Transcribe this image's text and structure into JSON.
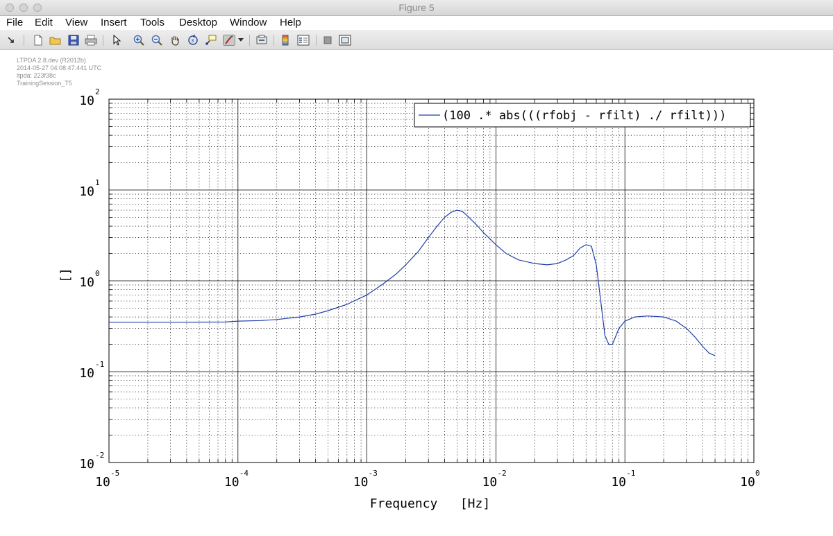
{
  "window": {
    "title": "Figure 5"
  },
  "menu": {
    "items": [
      "File",
      "Edit",
      "View",
      "Insert",
      "Tools",
      "Desktop",
      "Window",
      "Help"
    ]
  },
  "toolbar": {
    "icons": [
      "arrow-icon",
      "new-figure-icon",
      "open-icon",
      "save-icon",
      "print-icon",
      "pointer-icon",
      "zoom-in-icon",
      "zoom-out-icon",
      "pan-icon",
      "rotate-3d-icon",
      "data-cursor-icon",
      "brush-icon",
      "brush-dropdown-icon",
      "link-plot-icon",
      "colorbar-icon",
      "legend-icon",
      "hide-plot-tools-icon",
      "show-plot-tools-icon"
    ]
  },
  "metadata": {
    "lines": [
      "LTPDA 2.8.dev (R2012b)",
      "2014-05-27 04:08:47.441 UTC",
      "ltpda: 223f38c",
      "TrainingSession_T5"
    ]
  },
  "colors": {
    "series": "#1f3fa8",
    "grid_major": "#000000",
    "grid_minor": "#000000"
  },
  "chart_data": {
    "type": "line",
    "xscale": "log",
    "yscale": "log",
    "xlim": [
      1e-05,
      1
    ],
    "ylim": [
      0.01,
      100
    ],
    "xlabel": "Frequency   [Hz]",
    "ylabel": "[]",
    "grid": "major and minor",
    "legend_position": "top-right",
    "x_ticks": [
      {
        "base": "10",
        "exp": "-5"
      },
      {
        "base": "10",
        "exp": "-4"
      },
      {
        "base": "10",
        "exp": "-3"
      },
      {
        "base": "10",
        "exp": "-2"
      },
      {
        "base": "10",
        "exp": "-1"
      },
      {
        "base": "10",
        "exp": "0"
      }
    ],
    "y_ticks": [
      {
        "base": "10",
        "exp": "-2"
      },
      {
        "base": "10",
        "exp": "-1"
      },
      {
        "base": "10",
        "exp": "0"
      },
      {
        "base": "10",
        "exp": "1"
      },
      {
        "base": "10",
        "exp": "2"
      }
    ],
    "series": [
      {
        "name": "(100 .* abs(((rfobj - rfilt) ./ rfilt)))",
        "x": [
          1e-05,
          3e-05,
          8e-05,
          0.0001,
          0.00015,
          0.0002,
          0.0003,
          0.0004,
          0.0005,
          0.0007,
          0.001,
          0.0013,
          0.0017,
          0.002,
          0.0025,
          0.003,
          0.0035,
          0.004,
          0.0045,
          0.005,
          0.0055,
          0.006,
          0.007,
          0.008,
          0.01,
          0.012,
          0.015,
          0.02,
          0.025,
          0.03,
          0.035,
          0.04,
          0.045,
          0.05,
          0.055,
          0.06,
          0.065,
          0.07,
          0.075,
          0.08,
          0.09,
          0.1,
          0.12,
          0.15,
          0.2,
          0.25,
          0.3,
          0.35,
          0.4,
          0.45,
          0.5
        ],
        "y": [
          0.35,
          0.35,
          0.352,
          0.36,
          0.365,
          0.375,
          0.4,
          0.43,
          0.47,
          0.55,
          0.7,
          0.9,
          1.2,
          1.5,
          2.1,
          3.0,
          4.0,
          5.0,
          5.7,
          6.0,
          5.8,
          5.2,
          4.2,
          3.4,
          2.5,
          2.0,
          1.7,
          1.55,
          1.5,
          1.55,
          1.7,
          1.9,
          2.3,
          2.5,
          2.4,
          1.5,
          0.6,
          0.25,
          0.2,
          0.2,
          0.3,
          0.36,
          0.4,
          0.41,
          0.4,
          0.36,
          0.3,
          0.24,
          0.19,
          0.16,
          0.15
        ]
      }
    ]
  }
}
